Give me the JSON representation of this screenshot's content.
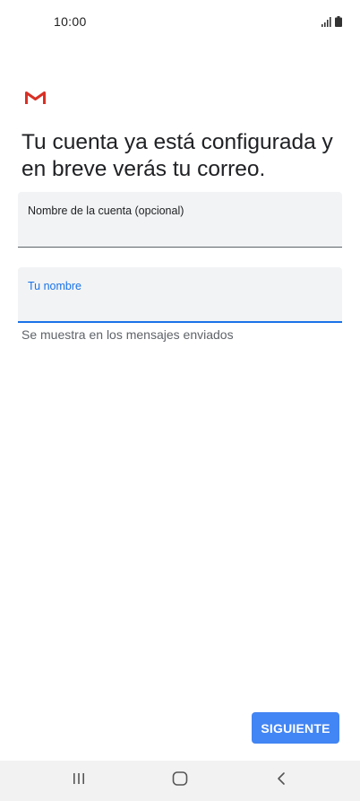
{
  "status_bar": {
    "time": "10:00"
  },
  "header": {
    "logo_icon": "gmail-logo-icon",
    "title": "Tu cuenta ya está configurada y en breve verás tu correo."
  },
  "form": {
    "account_name": {
      "label": "Nombre de la cuenta (opcional)",
      "value": ""
    },
    "your_name": {
      "label": "Tu nombre",
      "value": "",
      "helper": "Se muestra en los mensajes enviados"
    }
  },
  "actions": {
    "next_label": "SIGUIENTE"
  },
  "nav_bar": {
    "icons": [
      "recent-apps-icon",
      "home-icon",
      "back-icon"
    ]
  },
  "colors": {
    "accent": "#1a73e8",
    "button": "#4285f4",
    "field_bg": "#f1f3f4",
    "gmail_red": "#d93025"
  }
}
